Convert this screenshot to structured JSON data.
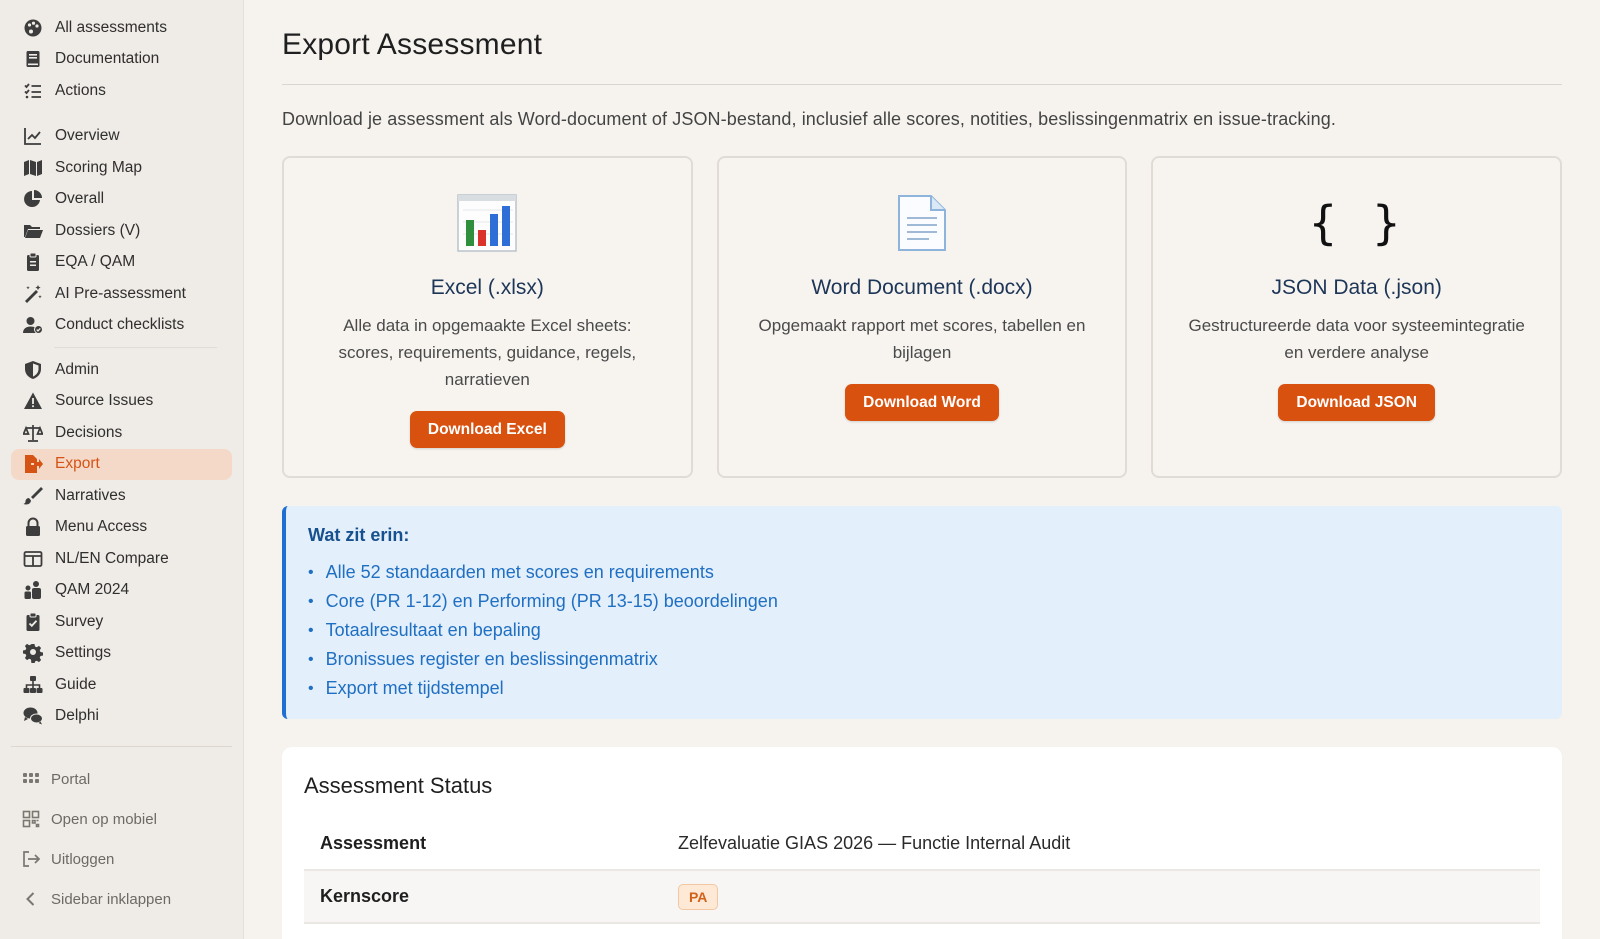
{
  "sidebar": {
    "group1": [
      {
        "label": "All assessments",
        "icon": "palette-icon"
      },
      {
        "label": "Documentation",
        "icon": "book-icon"
      },
      {
        "label": "Actions",
        "icon": "list-check-icon"
      }
    ],
    "group2": [
      {
        "label": "Overview",
        "icon": "line-chart-icon"
      },
      {
        "label": "Scoring Map",
        "icon": "map-icon"
      },
      {
        "label": "Overall",
        "icon": "pie-chart-icon"
      },
      {
        "label": "Dossiers (V)",
        "icon": "folder-open-icon"
      },
      {
        "label": "EQA / QAM",
        "icon": "clipboard-icon"
      },
      {
        "label": "AI Pre-assessment",
        "icon": "magic-wand-icon"
      },
      {
        "label": "Conduct checklists",
        "icon": "user-check-icon"
      }
    ],
    "group3": [
      {
        "label": "Admin",
        "icon": "shield-icon"
      },
      {
        "label": "Source Issues",
        "icon": "warning-icon"
      },
      {
        "label": "Decisions",
        "icon": "scale-icon"
      },
      {
        "label": "Export",
        "icon": "file-export-icon"
      },
      {
        "label": "Narratives",
        "icon": "brush-icon"
      },
      {
        "label": "Menu Access",
        "icon": "lock-icon"
      },
      {
        "label": "NL/EN Compare",
        "icon": "columns-icon"
      },
      {
        "label": "QAM 2024",
        "icon": "people-icon"
      },
      {
        "label": "Survey",
        "icon": "clipboard-check-icon"
      },
      {
        "label": "Settings",
        "icon": "gear-icon"
      },
      {
        "label": "Guide",
        "icon": "sitemap-icon"
      },
      {
        "label": "Delphi",
        "icon": "chat-icon"
      }
    ],
    "bottom": [
      {
        "label": "Portal",
        "icon": "grid-icon"
      },
      {
        "label": "Open op mobiel",
        "icon": "qr-icon"
      },
      {
        "label": "Uitloggen",
        "icon": "logout-icon"
      },
      {
        "label": "Sidebar inklappen",
        "icon": "chevron-left-icon"
      }
    ],
    "active_color": "#d65316"
  },
  "main": {
    "title": "Export Assessment",
    "intro": "Download je assessment als Word-document of JSON-bestand, inclusief alle scores, notities, beslissingenmatrix en issue-tracking.",
    "cards": [
      {
        "title": "Excel (.xlsx)",
        "desc": "Alle data in opgemaakte Excel sheets: scores, requirements, guidance, regels, narratieven",
        "button": "Download Excel",
        "icon": "bar-chart-icon"
      },
      {
        "title": "Word Document (.docx)",
        "desc": "Opgemaakt rapport met scores, tabellen en bijlagen",
        "button": "Download Word",
        "icon": "document-icon"
      },
      {
        "title": "JSON Data (.json)",
        "desc": "Gestructureerde data voor systeemintegratie en verdere analyse",
        "button": "Download JSON",
        "icon": "braces-icon",
        "glyph": "{ }"
      }
    ],
    "info": {
      "title": "Wat zit erin:",
      "items": [
        "Alle 52 standaarden met scores en requirements",
        "Core (PR 1-12) en Performing (PR 13-15) beoordelingen",
        "Totaalresultaat en bepaling",
        "Bronissues register en beslissingenmatrix",
        "Export met tijdstempel"
      ]
    },
    "status": {
      "title": "Assessment Status",
      "rows": [
        {
          "key": "Assessment",
          "value": "Zelfevaluatie GIAS 2026 — Functie Internal Audit"
        },
        {
          "key": "Kernscore",
          "badge": "PA"
        }
      ]
    },
    "accent": "#d9510f",
    "info_color": "#1f6fc2"
  }
}
